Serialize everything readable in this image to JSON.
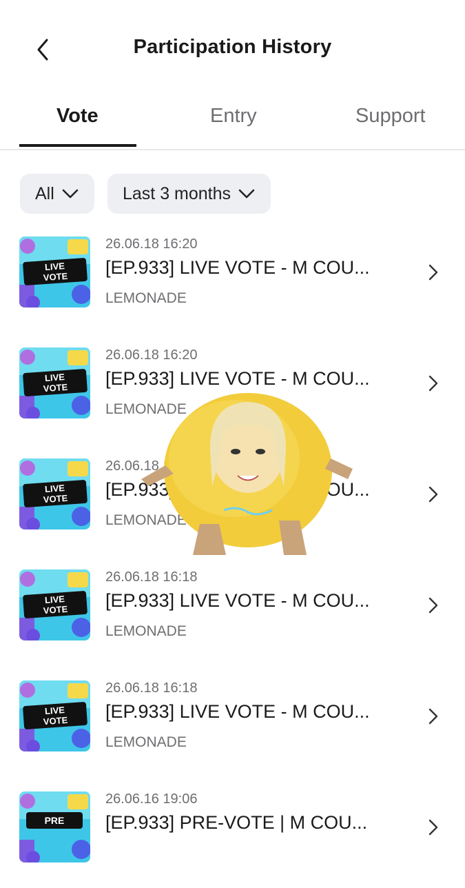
{
  "header": {
    "title": "Participation History",
    "back_icon": "chevron-left-icon"
  },
  "tabs": [
    {
      "label": "Vote",
      "active": true
    },
    {
      "label": "Entry",
      "active": false
    },
    {
      "label": "Support",
      "active": false
    }
  ],
  "filters": {
    "type": "All",
    "period": "Last 3 months"
  },
  "items": [
    {
      "date": "26.06.18 16:20",
      "title": "[EP.933] LIVE VOTE - M COU...",
      "artist": "LEMONADE",
      "thumb_badge": [
        "LIVE",
        "VOTE"
      ]
    },
    {
      "date": "26.06.18 16:20",
      "title": "[EP.933] LIVE VOTE - M COU...",
      "artist": "LEMONADE",
      "thumb_badge": [
        "LIVE",
        "VOTE"
      ]
    },
    {
      "date": "26.06.18 16:19",
      "title": "[EP.933] LIVE VOTE - M COU...",
      "artist": "LEMONADE",
      "thumb_badge": [
        "LIVE",
        "VOTE"
      ]
    },
    {
      "date": "26.06.18 16:18",
      "title": "[EP.933] LIVE VOTE - M COU...",
      "artist": "LEMONADE",
      "thumb_badge": [
        "LIVE",
        "VOTE"
      ]
    },
    {
      "date": "26.06.18 16:18",
      "title": "[EP.933] LIVE VOTE - M COU...",
      "artist": "LEMONADE",
      "thumb_badge": [
        "LIVE",
        "VOTE"
      ]
    },
    {
      "date": "26.06.16 19:06",
      "title": "[EP.933] PRE-VOTE | M COU...",
      "artist": "",
      "thumb_badge": [
        "PRE",
        ""
      ]
    }
  ],
  "colors": {
    "accent": "#1a1a1a",
    "muted": "#6e6e72",
    "filter_bg": "#eeeff2",
    "thumb_bg": "#3ec6e8"
  }
}
